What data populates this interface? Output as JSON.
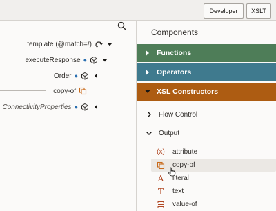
{
  "toolbar": {
    "developer_label": "Developer",
    "xslt_label": "XSLT"
  },
  "source_tree": [
    {
      "label": "template (@match=/)",
      "italic": false,
      "required": false,
      "icon": "template-icon",
      "caret": "down"
    },
    {
      "label": "executeResponse",
      "italic": false,
      "required": true,
      "icon": "cube-icon",
      "caret": "down"
    },
    {
      "label": "Order",
      "italic": false,
      "required": true,
      "icon": "cube-icon",
      "caret": "left"
    },
    {
      "label": "copy-of",
      "italic": false,
      "required": false,
      "icon": "copy-icon",
      "caret": "none"
    },
    {
      "label": "ConnectivityProperties",
      "italic": true,
      "required": true,
      "icon": "cube-icon",
      "caret": "left"
    }
  ],
  "components": {
    "title": "Components",
    "categories": [
      {
        "label": "Functions",
        "color": "#4e7d58"
      },
      {
        "label": "Operators",
        "color": "#3f7a8e"
      },
      {
        "label": "XSL Constructors",
        "color": "#ad5c12"
      }
    ],
    "flow_control_label": "Flow Control",
    "output_label": "Output",
    "output_items": [
      {
        "label": "attribute",
        "icon": "attribute-icon",
        "glyph": "(x)"
      },
      {
        "label": "copy-of",
        "icon": "copy-icon",
        "glyph": ""
      },
      {
        "label": "literal",
        "icon": "literal-icon",
        "glyph": "A"
      },
      {
        "label": "text",
        "icon": "text-icon",
        "glyph": "T"
      },
      {
        "label": "value-of",
        "icon": "value-of-icon",
        "glyph": ""
      }
    ]
  }
}
